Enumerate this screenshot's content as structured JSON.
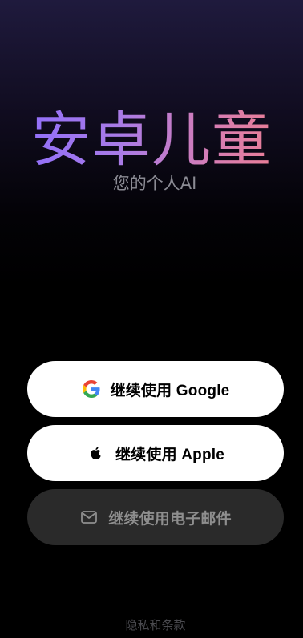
{
  "app": {
    "title": "安卓儿童",
    "subtitle": "您的个人AI",
    "title_gradient": [
      "#8b6cff",
      "#f27f89"
    ]
  },
  "auth_buttons": {
    "google": {
      "label": "继续使用 Google",
      "icon": "google-icon"
    },
    "apple": {
      "label": "继续使用 Apple",
      "icon": "apple-icon"
    },
    "email": {
      "label": "继续使用电子邮件",
      "icon": "mail-icon"
    }
  },
  "footer": {
    "privacy_label": "隐私和条款"
  },
  "colors": {
    "background": "#000000",
    "button_light": "#ffffff",
    "button_dark": "#2a2a2a",
    "muted_text": "#8e8e8e"
  }
}
